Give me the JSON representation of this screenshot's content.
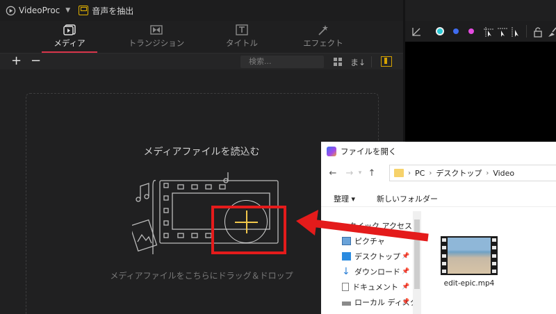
{
  "app": {
    "name": "VideoProc",
    "extract_label": "音声を抽出"
  },
  "tabs": [
    {
      "label": "メディア",
      "icon": "media-icon",
      "active": true
    },
    {
      "label": "トランジション",
      "icon": "transition-icon",
      "active": false
    },
    {
      "label": "タイトル",
      "icon": "title-icon",
      "active": false
    },
    {
      "label": "エフェクト",
      "icon": "effect-icon",
      "active": false
    }
  ],
  "toolbar": {
    "add_label": "+",
    "remove_label": "−",
    "search_placeholder": "検索...",
    "sort_label": "ま↓"
  },
  "media": {
    "title": "メディアファイルを読込む",
    "hint": "メディアファイルをこちらにドラッグ＆ドロップ"
  },
  "preview_toolbar": {
    "colors": [
      "#29c9d6",
      "#3f6cf0",
      "#e44be0"
    ]
  },
  "dialog": {
    "title": "ファイルを開く",
    "breadcrumb": [
      "PC",
      "デスクトップ",
      "Video"
    ],
    "organize_label": "整理 ▾",
    "new_folder_label": "新しいフォルダー",
    "nav_items": [
      {
        "label": "クイック アクセス",
        "icon": "star-icon"
      },
      {
        "label": "ピクチャ",
        "icon": "pictures-icon"
      },
      {
        "label": "デスクトップ",
        "icon": "desktop-icon"
      },
      {
        "label": "ダウンロード",
        "icon": "download-icon"
      },
      {
        "label": "ドキュメント",
        "icon": "document-icon"
      },
      {
        "label": "ローカル ディスク",
        "icon": "disk-icon"
      }
    ],
    "file_name": "edit-epic.mp4"
  }
}
